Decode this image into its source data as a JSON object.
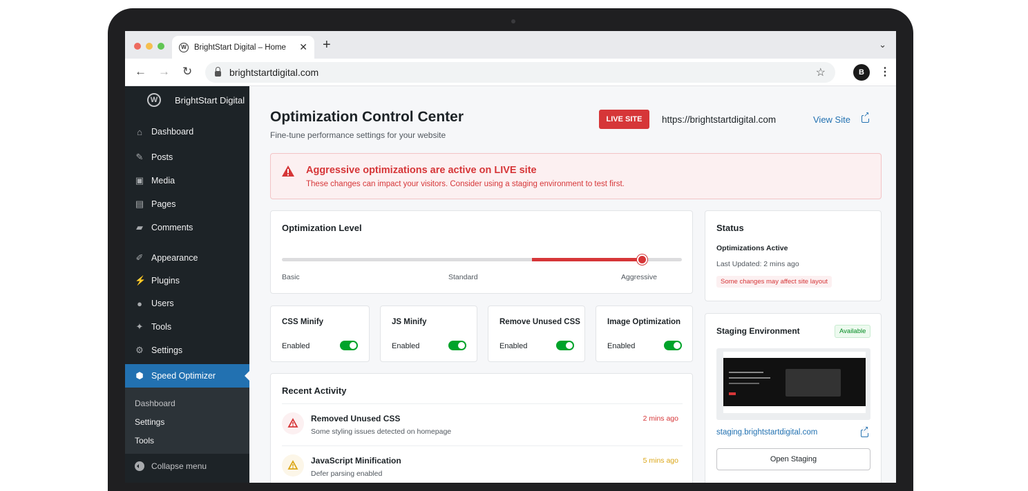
{
  "browser": {
    "tab_title": "BrightStart Digital – Home",
    "url": "brightstartdigital.com",
    "profile_initial": "B"
  },
  "sidebar": {
    "site_name": "BrightStart Digital",
    "items": [
      {
        "label": "Dashboard",
        "icon": "dashboard-icon"
      },
      {
        "label": "Posts",
        "icon": "pin-icon"
      },
      {
        "label": "Media",
        "icon": "media-icon"
      },
      {
        "label": "Pages",
        "icon": "pages-icon"
      },
      {
        "label": "Comments",
        "icon": "comment-icon"
      },
      {
        "label": "Appearance",
        "icon": "brush-icon"
      },
      {
        "label": "Plugins",
        "icon": "plug-icon"
      },
      {
        "label": "Users",
        "icon": "user-icon"
      },
      {
        "label": "Tools",
        "icon": "wrench-icon"
      },
      {
        "label": "Settings",
        "icon": "gear-icon"
      },
      {
        "label": "Speed Optimizer",
        "icon": "speed-icon"
      }
    ],
    "submenu": [
      "Dashboard",
      "Settings",
      "Tools"
    ],
    "collapse_label": "Collapse menu"
  },
  "header": {
    "title": "Optimization Control Center",
    "subtitle": "Fine-tune performance settings for your website",
    "live_badge": "LIVE SITE",
    "site_url": "https://brightstartdigital.com",
    "view_site": "View Site"
  },
  "alert": {
    "heading": "Aggressive optimizations are active on LIVE site",
    "body": "These changes can impact your visitors. Consider using a staging environment to test first."
  },
  "optimization": {
    "title": "Optimization Level",
    "levels": [
      "Basic",
      "Standard",
      "Aggressive"
    ],
    "level_value": 0.9
  },
  "toggles": [
    {
      "title": "CSS Minify",
      "state": "Enabled"
    },
    {
      "title": "JS Minify",
      "state": "Enabled"
    },
    {
      "title": "Remove Unused CSS",
      "state": "Enabled"
    },
    {
      "title": "Image Optimization",
      "state": "Enabled"
    }
  ],
  "activity": {
    "title": "Recent Activity",
    "items": [
      {
        "title": "Removed Unused CSS",
        "desc": "Some styling issues detected on homepage",
        "time": "2 mins ago",
        "color": "#d63638"
      },
      {
        "title": "JavaScript Minification",
        "desc": "Defer parsing enabled",
        "time": "5 mins ago",
        "color": "#dba617"
      }
    ]
  },
  "status": {
    "title": "Status",
    "state": "Optimizations Active",
    "updated": "Last Updated: 2 mins ago",
    "warning": "Some changes may affect site layout"
  },
  "staging": {
    "title": "Staging Environment",
    "badge": "Available",
    "url": "staging.brightstartdigital.com",
    "button": "Open Staging"
  },
  "colors": {
    "accent": "#2271b1",
    "danger": "#d63638",
    "success": "#00a32a",
    "sidebar": "#1d2327"
  }
}
